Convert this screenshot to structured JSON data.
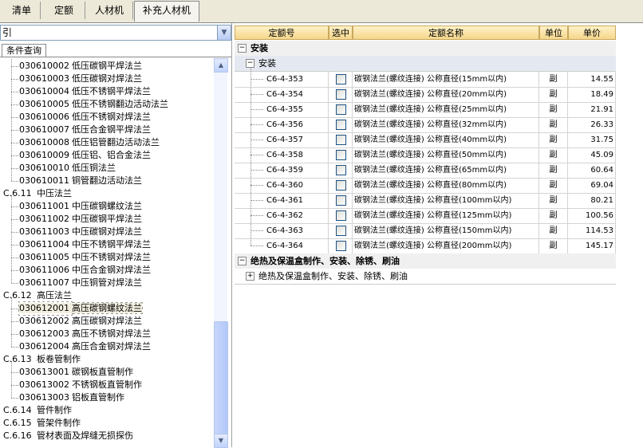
{
  "tabs": [
    "清单",
    "定额",
    "人材机",
    "补充人材机"
  ],
  "left": {
    "combo_value": "引",
    "subtab": "条件查询",
    "tree": [
      {
        "code": "030610002",
        "name": "低压碳钢平焊法兰",
        "level": 2
      },
      {
        "code": "030610003",
        "name": "低压碳钢对焊法兰",
        "level": 2
      },
      {
        "code": "030610004",
        "name": "低压不锈钢平焊法兰",
        "level": 2
      },
      {
        "code": "030610005",
        "name": "低压不锈钢翻边活动法兰",
        "level": 2
      },
      {
        "code": "030610006",
        "name": "低压不锈钢对焊法兰",
        "level": 2
      },
      {
        "code": "030610007",
        "name": "低压合金钢平焊法兰",
        "level": 2
      },
      {
        "code": "030610008",
        "name": "低压铝管翻边活动法兰",
        "level": 2
      },
      {
        "code": "030610009",
        "name": "低压铝、铝合金法兰",
        "level": 2
      },
      {
        "code": "030610010",
        "name": "低压铜法兰",
        "level": 2
      },
      {
        "code": "030610011",
        "name": "铜管翻边活动法兰",
        "level": 2
      },
      {
        "code": "C.6.11",
        "name": "中压法兰",
        "level": 1
      },
      {
        "code": "030611001",
        "name": "中压碳钢螺纹法兰",
        "level": 2
      },
      {
        "code": "030611002",
        "name": "中压碳钢平焊法兰",
        "level": 2
      },
      {
        "code": "030611003",
        "name": "中压碳钢对焊法兰",
        "level": 2
      },
      {
        "code": "030611004",
        "name": "中压不锈钢平焊法兰",
        "level": 2
      },
      {
        "code": "030611005",
        "name": "中压不锈钢对焊法兰",
        "level": 2
      },
      {
        "code": "030611006",
        "name": "中压合金钢对焊法兰",
        "level": 2
      },
      {
        "code": "030611007",
        "name": "中压铜管对焊法兰",
        "level": 2
      },
      {
        "code": "C.6.12",
        "name": "高压法兰",
        "level": 1
      },
      {
        "code": "030612001",
        "name": "高压碳钢螺纹法兰",
        "level": 2,
        "selected": true
      },
      {
        "code": "030612002",
        "name": "高压碳钢对焊法兰",
        "level": 2
      },
      {
        "code": "030612003",
        "name": "高压不锈钢对焊法兰",
        "level": 2
      },
      {
        "code": "030612004",
        "name": "高压合金钢对焊法兰",
        "level": 2
      },
      {
        "code": "C.6.13",
        "name": "板卷管制作",
        "level": 1
      },
      {
        "code": "030613001",
        "name": "碳钢板直管制作",
        "level": 2
      },
      {
        "code": "030613002",
        "name": "不锈钢板直管制作",
        "level": 2
      },
      {
        "code": "030613003",
        "name": "铝板直管制作",
        "level": 2
      },
      {
        "code": "C.6.14",
        "name": "管件制作",
        "level": 1
      },
      {
        "code": "C.6.15",
        "name": "管架件制作",
        "level": 1
      },
      {
        "code": "C.6.16",
        "name": "管材表面及焊缝无损探伤",
        "level": 1
      }
    ]
  },
  "grid": {
    "headers": [
      "定额号",
      "选中",
      "定额名称",
      "单位",
      "单价"
    ],
    "group1": "安装",
    "group1_sub": "安装",
    "group2": "绝热及保温盒制作、安装、除锈、刷油",
    "group2_sub": "绝热及保温盒制作、安装、除锈、刷油",
    "rows": [
      {
        "code": "C6-4-353",
        "name": "碳钢法兰(螺纹连接) 公称直径(15mm以内)",
        "unit": "副",
        "price": "14.55"
      },
      {
        "code": "C6-4-354",
        "name": "碳钢法兰(螺纹连接) 公称直径(20mm以内)",
        "unit": "副",
        "price": "18.49"
      },
      {
        "code": "C6-4-355",
        "name": "碳钢法兰(螺纹连接) 公称直径(25mm以内)",
        "unit": "副",
        "price": "21.91"
      },
      {
        "code": "C6-4-356",
        "name": "碳钢法兰(螺纹连接) 公称直径(32mm以内)",
        "unit": "副",
        "price": "26.33"
      },
      {
        "code": "C6-4-357",
        "name": "碳钢法兰(螺纹连接) 公称直径(40mm以内)",
        "unit": "副",
        "price": "31.75"
      },
      {
        "code": "C6-4-358",
        "name": "碳钢法兰(螺纹连接) 公称直径(50mm以内)",
        "unit": "副",
        "price": "45.09"
      },
      {
        "code": "C6-4-359",
        "name": "碳钢法兰(螺纹连接) 公称直径(65mm以内)",
        "unit": "副",
        "price": "60.64"
      },
      {
        "code": "C6-4-360",
        "name": "碳钢法兰(螺纹连接) 公称直径(80mm以内)",
        "unit": "副",
        "price": "69.04"
      },
      {
        "code": "C6-4-361",
        "name": "碳钢法兰(螺纹连接) 公称直径(100mm以内)",
        "unit": "副",
        "price": "80.21"
      },
      {
        "code": "C6-4-362",
        "name": "碳钢法兰(螺纹连接) 公称直径(125mm以内)",
        "unit": "副",
        "price": "100.56"
      },
      {
        "code": "C6-4-363",
        "name": "碳钢法兰(螺纹连接) 公称直径(150mm以内)",
        "unit": "副",
        "price": "114.53"
      },
      {
        "code": "C6-4-364",
        "name": "碳钢法兰(螺纹连接) 公称直径(200mm以内)",
        "unit": "副",
        "price": "145.17"
      }
    ]
  }
}
